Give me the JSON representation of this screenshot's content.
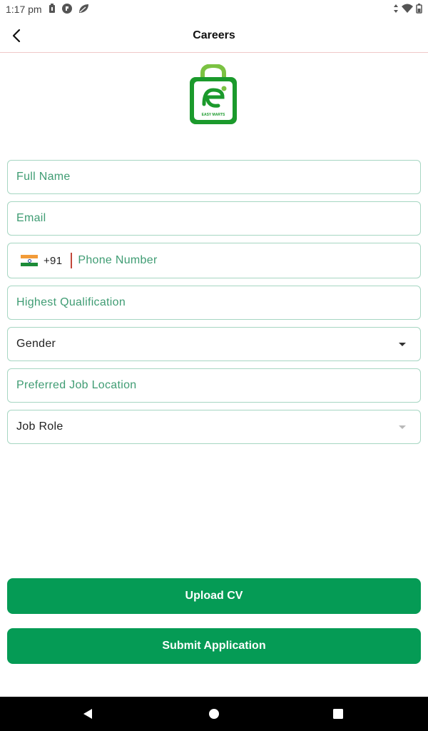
{
  "status_bar": {
    "time": "1:17 pm"
  },
  "app_bar": {
    "title": "Careers"
  },
  "logo": {
    "text": "EASY MARTS"
  },
  "form": {
    "full_name": {
      "placeholder": "Full Name"
    },
    "email": {
      "placeholder": "Email"
    },
    "phone": {
      "country_code": "+91",
      "placeholder": "Phone Number"
    },
    "qualification": {
      "placeholder": "Highest Qualification"
    },
    "gender": {
      "value": "Gender"
    },
    "job_location": {
      "placeholder": "Preferred Job Location"
    },
    "job_role": {
      "value": "Job Role"
    }
  },
  "buttons": {
    "upload_cv": "Upload CV",
    "submit": "Submit Application"
  },
  "colors": {
    "primary": "#059b55",
    "field_border": "#a6d6c2",
    "placeholder": "#3f9c73"
  },
  "icons": [
    "back-arrow-icon",
    "battery-icon",
    "notification-icon",
    "leaf-icon",
    "data-icon",
    "wifi-icon",
    "nav-back-icon",
    "nav-home-icon",
    "nav-recents-icon"
  ]
}
